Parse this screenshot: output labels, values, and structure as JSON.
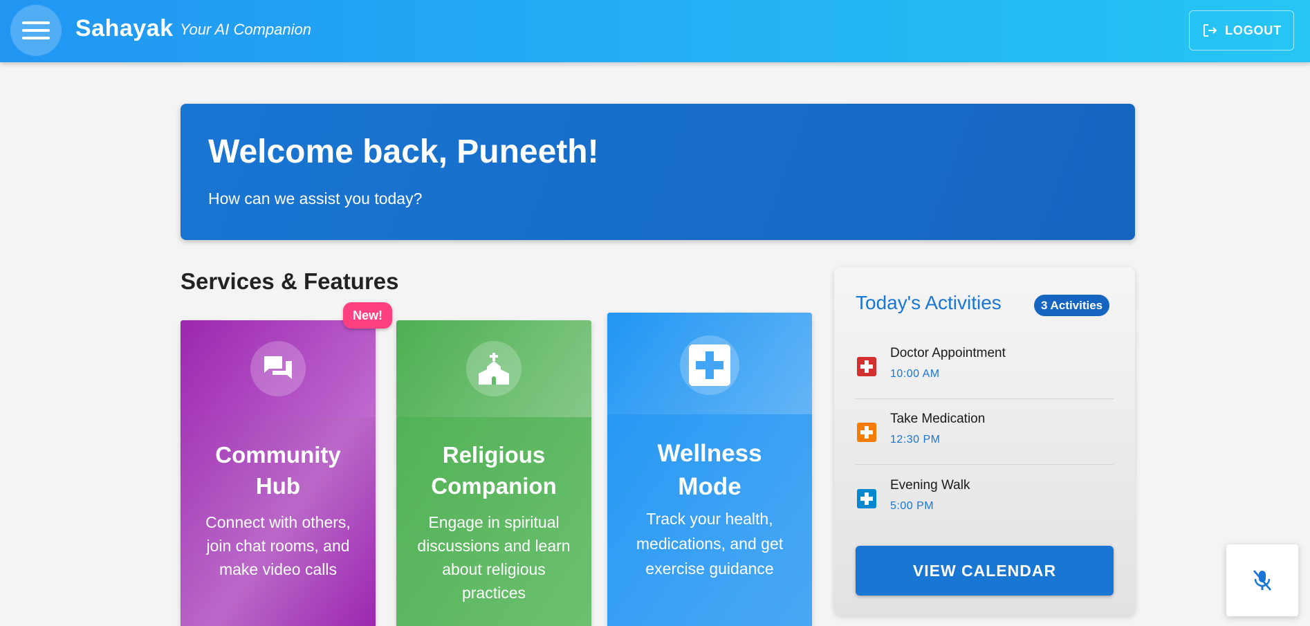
{
  "header": {
    "brand": "Sahayak",
    "tagline": "Your AI Companion",
    "logout_label": "LOGOUT"
  },
  "welcome": {
    "title": "Welcome back, Puneeth!",
    "subtitle": "How can we assist you today?"
  },
  "services": {
    "section_title": "Services & Features",
    "badge_new": "New!",
    "cards": [
      {
        "title": "Community Hub",
        "description": "Connect with others, join chat rooms, and make video calls",
        "icon": "chat-icon"
      },
      {
        "title": "Religious Companion",
        "description": "Engage in spiritual discussions and learn about religious practices",
        "icon": "church-icon"
      },
      {
        "title": "Wellness Mode",
        "description": "Track your health, medications, and get exercise guidance",
        "icon": "medical-cross-icon"
      }
    ]
  },
  "activities": {
    "title": "Today's Activities",
    "count_badge": "3 Activities",
    "items": [
      {
        "name": "Doctor Appointment",
        "time": "10:00 AM",
        "color": "#d32f2f"
      },
      {
        "name": "Take Medication",
        "time": "12:30 PM",
        "color": "#f57c00"
      },
      {
        "name": "Evening Walk",
        "time": "5:00 PM",
        "color": "#0288d1"
      }
    ],
    "button_label": "VIEW CALENDAR"
  },
  "colors": {
    "primary": "#1976d2",
    "community": "#9c27b0",
    "religious": "#4caf50",
    "wellness": "#2196f3",
    "badge_new": "#ff4081"
  }
}
